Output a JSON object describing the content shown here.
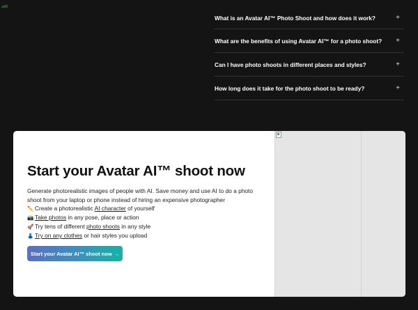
{
  "corner_text": "ad0",
  "faq": {
    "items": [
      {
        "question": "What is an Avatar AI™ Photo Shoot and how does it work?",
        "toggle": "+"
      },
      {
        "question": "What are the benefits of using Avatar AI™ for a photo shoot?",
        "toggle": "+"
      },
      {
        "question": "Can I have photo shoots in different places and styles?",
        "toggle": "+"
      },
      {
        "question": "How long does it take for the photo shoot to be ready?",
        "toggle": "+"
      }
    ]
  },
  "cta": {
    "title": "Start your Avatar AI™ shoot now",
    "description": "Generate photorealistic images of people with AI. Save money and use AI to do a photo shoot from your laptop or phone instead of hiring an expensive photographer",
    "features": [
      {
        "emoji": "✏️",
        "before": "Create a photorealistic ",
        "link": "AI character",
        "after": " of yourself"
      },
      {
        "emoji": "📸",
        "before": "",
        "link": "Take photos",
        "after": " in any pose, place or action"
      },
      {
        "emoji": "🚀",
        "before": "Try tens of different ",
        "link": "photo shoots",
        "after": " in any style"
      },
      {
        "emoji": "👗",
        "before": "",
        "link": "Try on any clothes",
        "after": " or hair styles you upload"
      }
    ],
    "button_label": "Start your Avatar AI™ shoot now",
    "button_arrow": "→"
  },
  "colors": {
    "page_background": "#141414",
    "card_background": "#ffffff",
    "gradient_start": "#5a6fc4",
    "gradient_end": "#14b3a4",
    "image_placeholder": "#e5e5e5"
  }
}
